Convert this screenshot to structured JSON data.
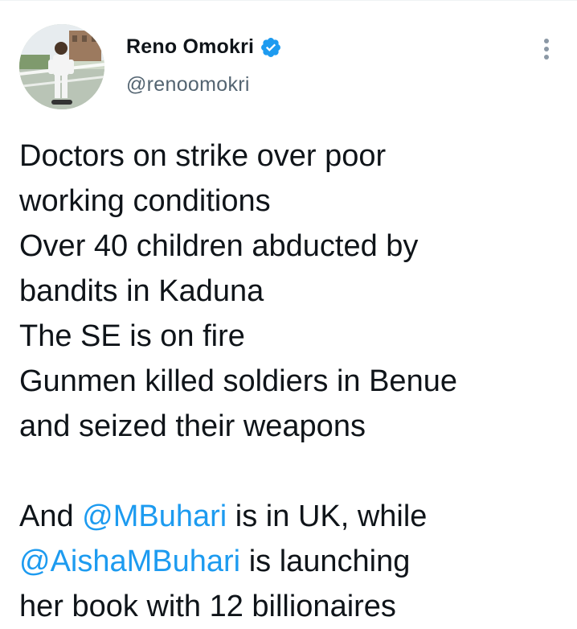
{
  "author": {
    "name": "Reno Omokri",
    "handle": "@renoomokri",
    "verified": true,
    "verified_icon": "verified-badge-icon",
    "avatar_icon": "profile-photo"
  },
  "menu_icon": "more-vertical-icon",
  "colors": {
    "text": "#0f1419",
    "secondary": "#536471",
    "link": "#1d9bf0",
    "verified": "#1d9bf0"
  },
  "tweet": {
    "lines": [
      "Doctors on strike over poor",
      "working conditions",
      "Over 40 children abducted by",
      "bandits in Kaduna",
      "The SE is on fire",
      "Gunmen killed soldiers in Benue",
      "and seized their weapons"
    ],
    "para2_l1_a": "And ",
    "para2_l1_mention": "@MBuhari",
    "para2_l1_b": " is in UK, while",
    "para2_l2_mention": "@AishaMBuhari",
    "para2_l2_b": " is launching",
    "para2_l3": "her book with 12 billionaires"
  }
}
